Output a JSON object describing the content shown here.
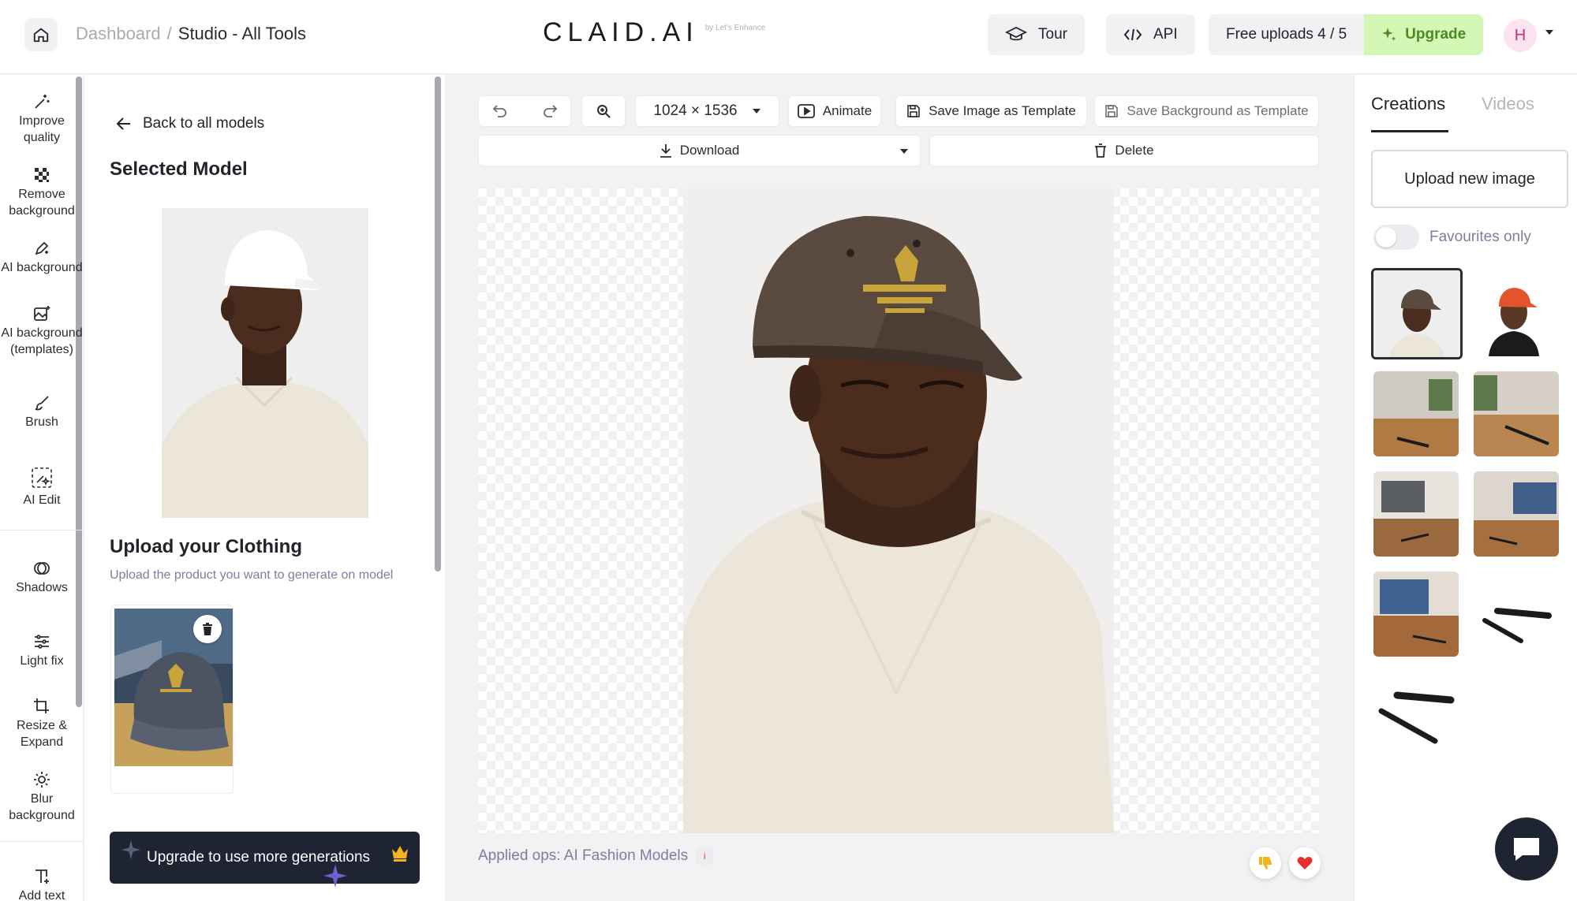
{
  "header": {
    "breadcrumb_root": "Dashboard",
    "breadcrumb_separator": "/",
    "breadcrumb_current": "Studio - All Tools",
    "logo_text": "CLAID.AI",
    "logo_sub": "by Let's Enhance",
    "tour_label": "Tour",
    "api_label": "API",
    "uploads_label": "Free uploads 4 / 5",
    "upgrade_label": "Upgrade",
    "avatar_initial": "H"
  },
  "tools": [
    {
      "label": "Improve quality",
      "icon": "magic-wand-icon"
    },
    {
      "label": "Remove background",
      "icon": "checker-icon"
    },
    {
      "label": "AI background",
      "icon": "pen-sparkle-icon"
    },
    {
      "label": "AI background (templates)",
      "icon": "image-sparkle-icon"
    },
    {
      "label": "Brush",
      "icon": "brush-icon"
    },
    {
      "label": "AI Edit",
      "icon": "ai-edit-icon"
    },
    {
      "label": "Shadows",
      "icon": "shadow-icon"
    },
    {
      "label": "Light fix",
      "icon": "sliders-icon"
    },
    {
      "label": "Resize & Expand",
      "icon": "crop-icon"
    },
    {
      "label": "Blur background",
      "icon": "blur-icon"
    },
    {
      "label": "Add text",
      "icon": "add-text-icon"
    }
  ],
  "panel": {
    "back_label": "Back to all models",
    "selected_model_title": "Selected Model",
    "upload_title": "Upload your Clothing",
    "upload_subtitle": "Upload the product you want to generate on model",
    "upgrade_generations": "Upgrade to use more generations"
  },
  "toolbar": {
    "size_label": "1024 × 1536",
    "animate_label": "Animate",
    "save_template_label": "Save Image as Template",
    "save_bg_template_label": "Save Background as Template",
    "download_label": "Download",
    "delete_label": "Delete"
  },
  "canvas": {
    "applied_ops": "Applied ops: AI Fashion Models",
    "info_badge": "i"
  },
  "creations": {
    "tab_creations": "Creations",
    "tab_videos": "Videos",
    "upload_new_label": "Upload new image",
    "favourites_label": "Favourites only",
    "favourites_on": false
  },
  "colors": {
    "upgrade_bg": "#d5f7b6",
    "upgrade_text": "#4e8a1f",
    "dark": "#1f2433",
    "muted": "#7b7f9e"
  }
}
